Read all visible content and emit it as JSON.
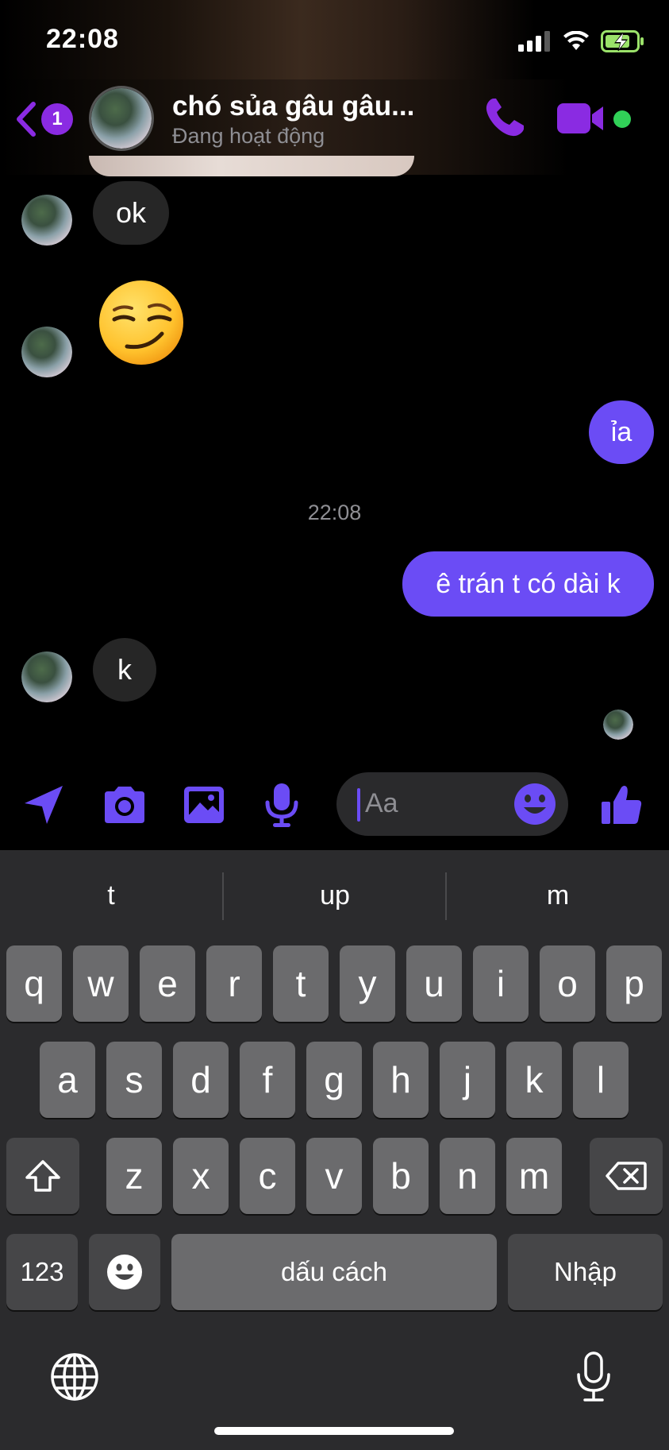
{
  "status_bar": {
    "time": "22:08"
  },
  "header": {
    "back_badge": "1",
    "contact_name": "chó sủa gâu gâu...",
    "contact_status": "Đang hoạt động",
    "accent_color": "#8a2be2",
    "online_color": "#31d158"
  },
  "messages": [
    {
      "from": "them",
      "type": "text",
      "text": "ok"
    },
    {
      "from": "them",
      "type": "emoji",
      "icon": "smirking-face-emoji"
    },
    {
      "from": "me",
      "type": "text",
      "text": "ỉa"
    },
    {
      "from": "system",
      "type": "timestamp",
      "text": "22:08"
    },
    {
      "from": "me",
      "type": "text",
      "text": "ê trán t có dài k"
    },
    {
      "from": "them",
      "type": "text",
      "text": "k"
    }
  ],
  "composer": {
    "placeholder": "Aa",
    "icons": [
      "location-icon",
      "camera-icon",
      "gallery-icon",
      "microphone-icon",
      "emoji-icon",
      "like-icon"
    ],
    "accent_color": "#6b4cf5"
  },
  "keyboard": {
    "suggestions": [
      "t",
      "up",
      "m"
    ],
    "row1": [
      "q",
      "w",
      "e",
      "r",
      "t",
      "y",
      "u",
      "i",
      "o",
      "p"
    ],
    "row2": [
      "a",
      "s",
      "d",
      "f",
      "g",
      "h",
      "j",
      "k",
      "l"
    ],
    "row3": [
      "z",
      "x",
      "c",
      "v",
      "b",
      "n",
      "m"
    ],
    "numbers_key": "123",
    "space_key": "dấu cách",
    "return_key": "Nhập"
  }
}
